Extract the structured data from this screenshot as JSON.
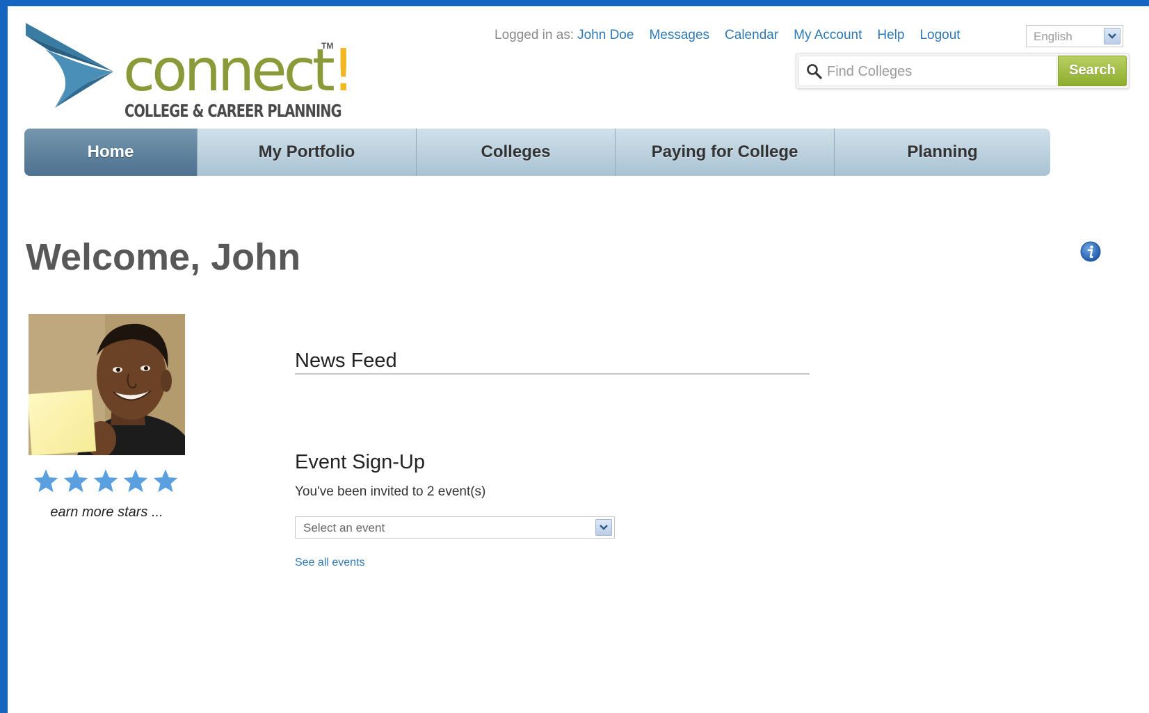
{
  "brand": {
    "name": "connect",
    "exclaim": "!",
    "tagline": "COLLEGE & CAREER PLANNING",
    "tm": "TM"
  },
  "header": {
    "logged_in_label": "Logged in as:",
    "user_name": "John Doe",
    "links": [
      "Messages",
      "Calendar",
      "My Account",
      "Help",
      "Logout"
    ],
    "language": "English"
  },
  "search": {
    "placeholder": "Find Colleges",
    "button_label": "Search"
  },
  "nav": {
    "items": [
      "Home",
      "My Portfolio",
      "Colleges",
      "Paying for College",
      "Planning"
    ],
    "active": "Home"
  },
  "page": {
    "title": "Welcome, John"
  },
  "profile": {
    "stars": 5,
    "star_color": "#5aa0e0",
    "earn_text": "earn more stars ..."
  },
  "news_feed": {
    "title": "News Feed"
  },
  "events": {
    "title": "Event Sign-Up",
    "invite_text": "You've been invited to 2 event(s)",
    "select_placeholder": "Select an event",
    "see_all_label": "See all events"
  },
  "colors": {
    "accent_link": "#2f79b5",
    "brand_green": "#8b9a38",
    "brand_yellow": "#f2b622",
    "frame_blue": "#1565c0"
  }
}
